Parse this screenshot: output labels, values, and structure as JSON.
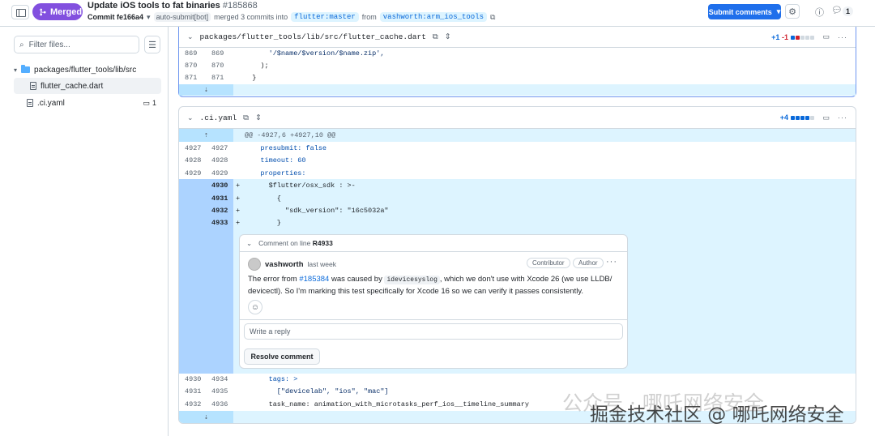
{
  "header": {
    "status": "Merged",
    "title": "Update iOS tools to fat binaries",
    "pr_number": "#185868",
    "commit_label": "Commit fe166a4",
    "author": "auto-submit[bot]",
    "merged_text": "merged 3 commits into",
    "base_branch": "flutter:master",
    "from_text": "from",
    "head_branch": "vashworth:arm_ios_tools",
    "submit_label": "Submit comments",
    "comment_count": "1"
  },
  "sidebar": {
    "filter_placeholder": "Filter files...",
    "folder": "packages/flutter_tools/lib/src",
    "file1": "flutter_cache.dart",
    "file2": ".ci.yaml",
    "file2_comments": "1"
  },
  "diff1": {
    "path": "packages/flutter_tools/lib/src/flutter_cache.dart",
    "stats_add": "+1",
    "stats_del": "-1",
    "lines": [
      {
        "old": "869",
        "new": "869",
        "code": "      '/$name/$version/$name.zip',"
      },
      {
        "old": "870",
        "new": "870",
        "code": "    );"
      },
      {
        "old": "871",
        "new": "871",
        "code": "  }"
      }
    ]
  },
  "diff2": {
    "path": ".ci.yaml",
    "stats_add": "+4",
    "hunk": "@@ -4927,6 +4927,10 @@",
    "context1": [
      {
        "old": "4927",
        "new": "4927",
        "code": "    presubmit: false"
      },
      {
        "old": "4928",
        "new": "4928",
        "code": "    timeout: 60"
      },
      {
        "old": "4929",
        "new": "4929",
        "code": "    properties:"
      }
    ],
    "added": [
      {
        "new": "4930",
        "sign": "+",
        "code": "      $flutter/osx_sdk : >-"
      },
      {
        "new": "4931",
        "sign": "+",
        "code": "        {"
      },
      {
        "new": "4932",
        "sign": "+",
        "code": "          \"sdk_version\": \"16c5032a\""
      },
      {
        "new": "4933",
        "sign": "+",
        "code": "        }"
      }
    ],
    "context2": [
      {
        "old": "4930",
        "new": "4934",
        "code": "      tags: >"
      },
      {
        "old": "4931",
        "new": "4935",
        "code": "        [\"devicelab\", \"ios\", \"mac\"]"
      },
      {
        "old": "4932",
        "new": "4936",
        "code": "      task_name: animation_with_microtasks_perf_ios__timeline_summary"
      }
    ]
  },
  "comment": {
    "header_prefix": "Comment on line",
    "header_line": "R4933",
    "author": "vashworth",
    "time": "last week",
    "role1": "Contributor",
    "role2": "Author",
    "body_1": "The error from",
    "body_link": "#185384",
    "body_2": "was caused by",
    "body_code": "idevicesyslog",
    "body_3": ", which we don't use with Xcode 26 (we use LLDB/ devicectl). So I'm marking this test specifically for Xcode 16 so we can verify it passes consistently.",
    "reply_placeholder": "Write a reply",
    "resolve_label": "Resolve comment"
  },
  "watermark": {
    "line1": "公众号 · 哪吒网络安全",
    "line2": "掘金技术社区 @ 哪吒网络安全"
  },
  "colors": {
    "merged": "#8250df",
    "primary_button": "#1f6feb",
    "addition_bg": "#ddf4ff",
    "link": "#0969da"
  }
}
